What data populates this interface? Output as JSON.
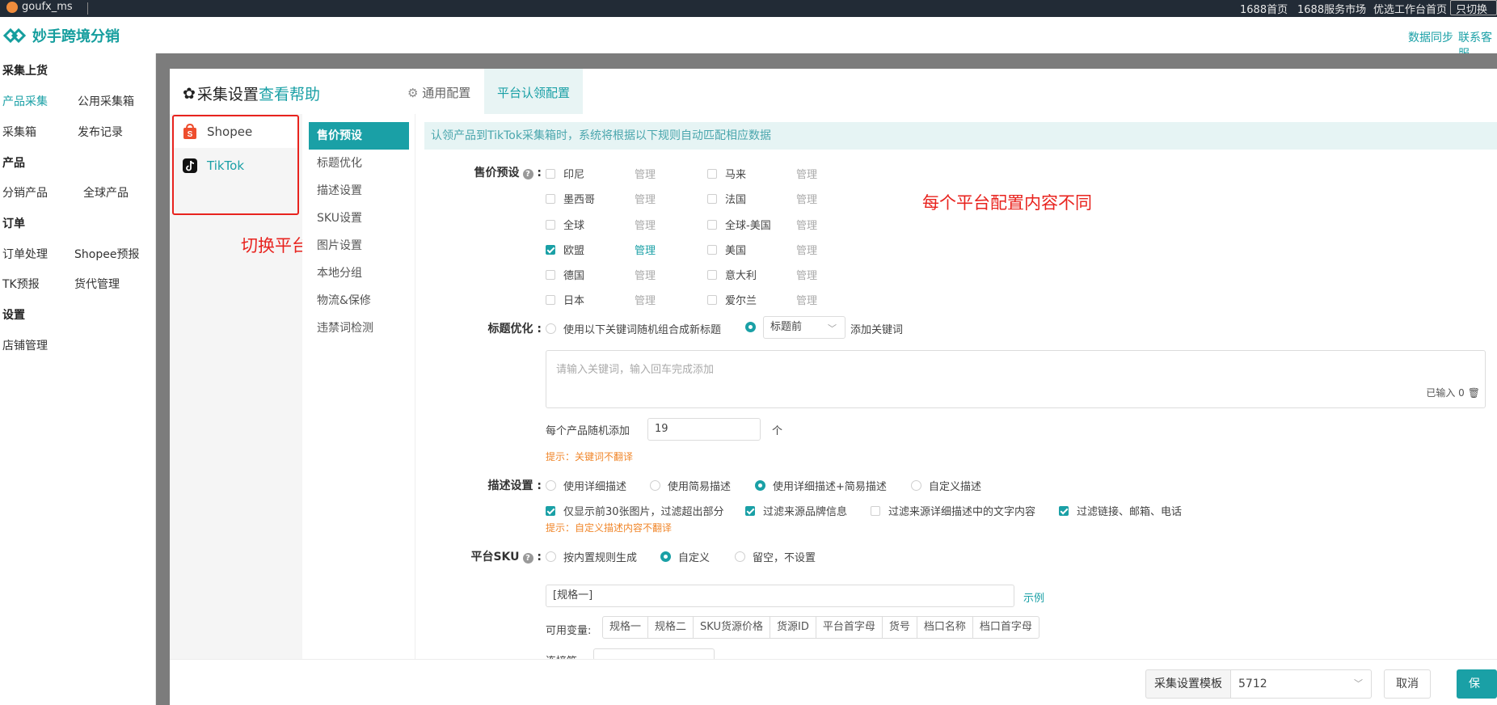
{
  "topbar": {
    "user": "goufx_ms",
    "links": [
      "1688首页",
      "1688服务市场",
      "优选工作台首页"
    ],
    "switch_label": "只切换为"
  },
  "header": {
    "brand": "妙手跨境分销",
    "links": [
      "数据同步",
      "联系客服"
    ]
  },
  "sidebar": {
    "sections": [
      {
        "title": "采集上货",
        "items": [
          "产品采集",
          "公用采集箱",
          "采集箱",
          "发布记录"
        ]
      },
      {
        "title": "产品",
        "items": [
          "分销产品",
          "全球产品"
        ]
      },
      {
        "title": "订单",
        "items": [
          "订单处理",
          "Shopee预报",
          "TK预报",
          "货代管理"
        ]
      },
      {
        "title": "设置",
        "items": [
          "店铺管理"
        ]
      }
    ],
    "active_item": "产品采集"
  },
  "modal": {
    "title": "采集设置",
    "help_link": "查看帮助",
    "tabs": [
      "通用配置",
      "平台认领配置"
    ],
    "active_tab": "平台认领配置",
    "platforms": [
      "Shopee",
      "TikTok"
    ],
    "active_platform": "TikTok",
    "annotation_switch": "切换平台",
    "annotation_diff": "每个平台配置内容不同",
    "nav": [
      "售价预设",
      "标题优化",
      "描述设置",
      "SKU设置",
      "图片设置",
      "本地分组",
      "物流&保修",
      "违禁词检测"
    ],
    "active_nav": "售价预设",
    "info": "认领产品到TikTok采集箱时，系统将根据以下规则自动匹配相应数据",
    "price": {
      "label": "售价预设",
      "manage": "管理",
      "countries": [
        {
          "name": "印尼",
          "checked": false
        },
        {
          "name": "马来",
          "checked": false
        },
        {
          "name": "墨西哥",
          "checked": false
        },
        {
          "name": "法国",
          "checked": false
        },
        {
          "name": "全球",
          "checked": false
        },
        {
          "name": "全球-美国",
          "checked": false
        },
        {
          "name": "欧盟",
          "checked": true
        },
        {
          "name": "美国",
          "checked": false
        },
        {
          "name": "德国",
          "checked": false
        },
        {
          "name": "意大利",
          "checked": false
        },
        {
          "name": "日本",
          "checked": false
        },
        {
          "name": "爱尔兰",
          "checked": false
        }
      ]
    },
    "title_opt": {
      "label": "标题优化",
      "option1": "使用以下关键词随机组合成新标题",
      "select_value": "标题前",
      "add_keyword": "添加关键词",
      "placeholder": "请输入关键词，输入回车完成添加",
      "counter": "已输入 0",
      "random_label": "每个产品随机添加",
      "random_value": "19",
      "unit": "个",
      "hint": "提示：关键词不翻译"
    },
    "desc": {
      "label": "描述设置",
      "radios": [
        "使用详细描述",
        "使用简易描述",
        "使用详细描述+简易描述",
        "自定义描述"
      ],
      "selected": "使用详细描述+简易描述",
      "checks": [
        {
          "label": "仅显示前30张图片，过滤超出部分",
          "checked": true
        },
        {
          "label": "过滤来源品牌信息",
          "checked": true
        },
        {
          "label": "过滤来源详细描述中的文字内容",
          "checked": false
        },
        {
          "label": "过滤链接、邮箱、电话",
          "checked": true
        }
      ],
      "hint": "提示：自定义描述内容不翻译"
    },
    "sku": {
      "label": "平台SKU",
      "radios": [
        "按内置规则生成",
        "自定义",
        "留空，不设置"
      ],
      "selected": "自定义",
      "value": "[规格一]",
      "example": "示例",
      "vars_label": "可用变量:",
      "vars": [
        "规格一",
        "规格二",
        "SKU货源价格",
        "货源ID",
        "平台首字母",
        "货号",
        "档口名称",
        "档口首字母"
      ],
      "connector_label": "连接符:"
    },
    "footer": {
      "template_label": "采集设置模板",
      "template_value": "5712",
      "cancel": "取消",
      "save": "保存"
    }
  }
}
